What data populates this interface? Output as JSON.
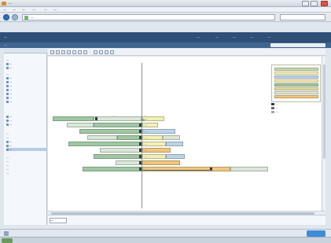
{
  "window": {
    "title": "—",
    "controls": [
      "minimize",
      "maximize",
      "close"
    ]
  },
  "menubar": {
    "items": [
      "—",
      "—",
      "—",
      "—",
      "—",
      "—"
    ]
  },
  "address": {
    "url": "—",
    "search_placeholder": ""
  },
  "app": {
    "brand": "—",
    "header_links": [
      "—",
      "—",
      "—",
      "—",
      "—"
    ],
    "breadcrumb": "—"
  },
  "sidebar": {
    "sections": [
      {
        "label": "—",
        "items": [
          "—",
          "—"
        ]
      },
      {
        "label": "—",
        "items": [
          "—",
          "—",
          "—",
          "—",
          "—",
          "—",
          "—"
        ]
      },
      {
        "label": "—",
        "items": [
          "—",
          "—",
          "—"
        ]
      },
      {
        "label": "—",
        "items": [
          "—",
          "—",
          "—"
        ]
      },
      {
        "label": "—",
        "items": [
          "—",
          "—",
          "—",
          "—"
        ]
      }
    ],
    "selected_item": "—"
  },
  "canvas": {
    "column_headers": [
      "—",
      "—"
    ],
    "rows": [
      {
        "label_left": "—",
        "label_right": "—"
      },
      {
        "label_left": "—",
        "label_right": "—"
      },
      {
        "label_left": "—",
        "label_right": "—"
      },
      {
        "label_left": "—",
        "label_right": "—"
      },
      {
        "label_left": "—",
        "label_right": "—"
      },
      {
        "label_left": "—",
        "label_right": "—"
      },
      {
        "label_left": "—",
        "label_right": "—"
      },
      {
        "label_left": "—",
        "label_right": "—"
      },
      {
        "label_left": "—",
        "label_right": "—"
      }
    ]
  },
  "legend": {
    "colors": [
      "#9fc7a3",
      "#f3efb4",
      "#f2c57c",
      "#dbe6d9",
      "#bcd3ea",
      "#c8d8b0",
      "#f7e8b0",
      "#e7d9a0"
    ],
    "entries": [
      "—",
      "—",
      "—"
    ]
  },
  "bottom_panel": {
    "tab_label": "—"
  },
  "colors": {
    "header": "#2f4f76",
    "accent_button": "#3f8bd6"
  }
}
